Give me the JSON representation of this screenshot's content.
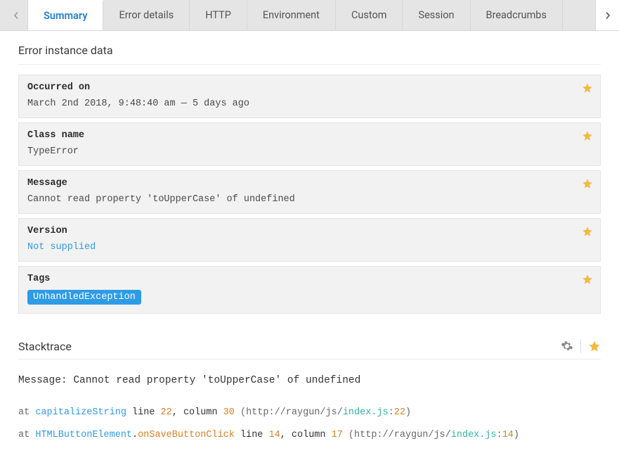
{
  "tabs": {
    "items": [
      {
        "label": "Summary"
      },
      {
        "label": "Error details"
      },
      {
        "label": "HTTP"
      },
      {
        "label": "Environment"
      },
      {
        "label": "Custom"
      },
      {
        "label": "Session"
      },
      {
        "label": "Breadcrumbs"
      }
    ],
    "active_index": 0
  },
  "sections": {
    "instance_title": "Error instance data",
    "stacktrace_title": "Stacktrace"
  },
  "fields": {
    "occurred_on": {
      "label": "Occurred on",
      "value": "March 2nd 2018, 9:48:40 am — 5 days ago"
    },
    "class_name": {
      "label": "Class name",
      "value": "TypeError"
    },
    "message": {
      "label": "Message",
      "value": "Cannot read property 'toUpperCase' of undefined"
    },
    "version": {
      "label": "Version",
      "value": "Not supplied"
    },
    "tags": {
      "label": "Tags",
      "items": [
        "UnhandledException"
      ]
    }
  },
  "stacktrace": {
    "message_prefix": "Message: ",
    "message": "Cannot read property 'toUpperCase' of undefined",
    "frames": [
      {
        "at": "at ",
        "fn": "capitalizeString",
        "line_kw": " line ",
        "line": "22",
        "col_kw": ", column ",
        "col": "30",
        "open": " (http://raygun/js/",
        "file": "index.js",
        "sep": ":",
        "fline": "22",
        "close": ")"
      },
      {
        "at": "at ",
        "cls": "HTMLButtonElement",
        "dot": ".",
        "method": "onSaveButtonClick",
        "line_kw": " line ",
        "line": "14",
        "col_kw": ", column ",
        "col": "17",
        "open": " (http://raygun/js/",
        "file": "index.js",
        "sep": ":",
        "fline": "14",
        "close": ")"
      }
    ]
  }
}
